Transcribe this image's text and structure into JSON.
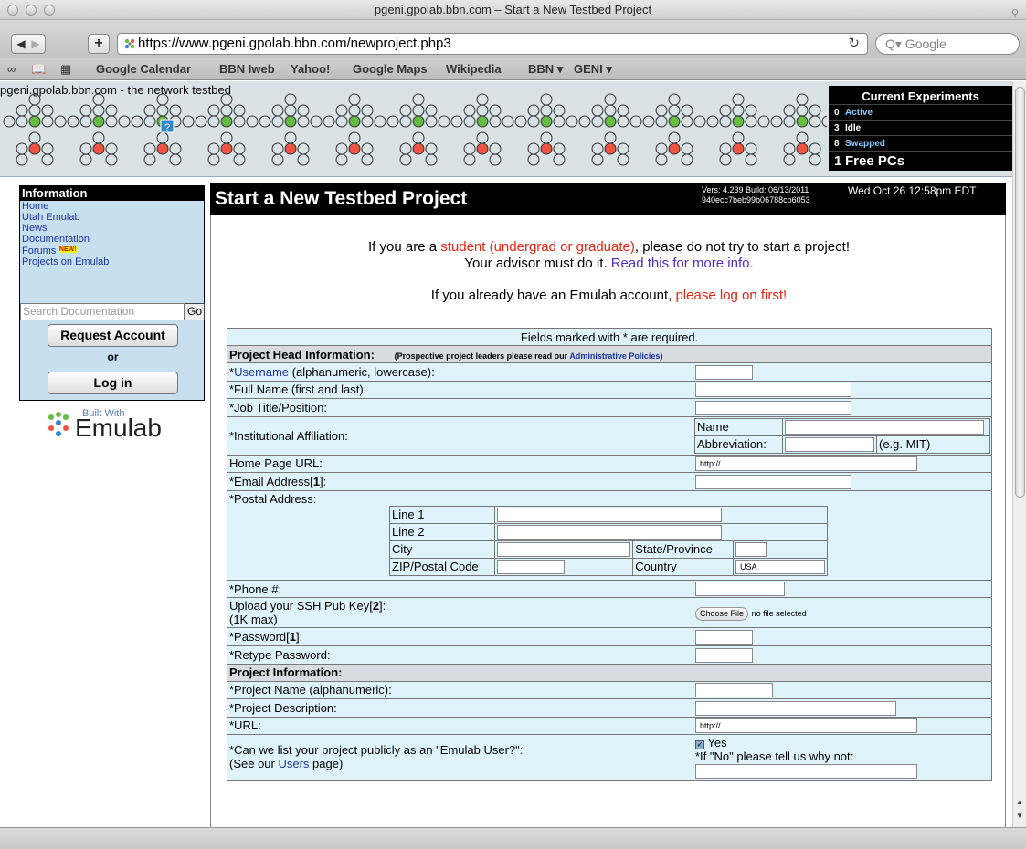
{
  "window": {
    "title": "pgeni.gpolab.bbn.com – Start a New Testbed Project"
  },
  "toolbar": {
    "url": "https://www.pgeni.gpolab.bbn.com/newproject.php3",
    "search_placeholder": "Q▾ Google"
  },
  "bookmarks": [
    "Google Calendar",
    "BBN Iweb",
    "Yahoo!",
    "Google Maps",
    "Wikipedia",
    "BBN ▾",
    "GENI ▾"
  ],
  "banner": {
    "title": "pgeni.gpolab.bbn.com - the network testbed",
    "experiments": {
      "heading": "Current Experiments",
      "active_count": "0",
      "active_label": "Active",
      "idle_count": "3",
      "idle_label": "Idle",
      "swapped_count": "8",
      "swapped_label": "Swapped",
      "free_count": "1",
      "free_label": "Free PCs"
    }
  },
  "sidebar": {
    "heading": "Information",
    "links": [
      "Home",
      "Utah Emulab",
      "News",
      "Documentation",
      "Forums",
      "Projects on Emulab"
    ],
    "new_badge": "NEW!",
    "search_placeholder": "Search Documentation",
    "go_label": "Go",
    "request_account": "Request Account",
    "or": "or",
    "log_in": "Log in",
    "built_with_small": "Built With",
    "built_with_big": "Emulab"
  },
  "header": {
    "title": "Start a New Testbed Project",
    "version_line1": "Vers: 4.239 Build: 06/13/2011",
    "version_line2": "940ecc7beb99b06788cb6053",
    "date": "Wed Oct 26 12:58pm EDT"
  },
  "intro": {
    "line1_pre": "If you are a ",
    "line1_link": "student (undergrad or graduate)",
    "line1_post": ", please do not try to start a project!",
    "line2_pre": "Your advisor must do it. ",
    "line2_link": "Read this for more info.",
    "line3_pre": "If you already have an Emulab account, ",
    "line3_link": "please log on first!"
  },
  "form": {
    "required_note": "Fields marked with * are required.",
    "section1": "Project Head Information:",
    "section1_note_pre": "(Prospective project leaders please read our ",
    "section1_note_link": "Administrative Policies",
    "section1_note_post": ")",
    "username_star": "*",
    "username_link": "Username",
    "username_rest": " (alphanumeric, lowercase):",
    "fullname": "*Full Name (first and last):",
    "jobtitle": "*Job Title/Position:",
    "affiliation": "*Institutional Affiliation:",
    "aff_name": "Name",
    "aff_abbrev": "Abbreviation:",
    "aff_example": "(e.g. MIT)",
    "homepage": "Home Page URL:",
    "homepage_value": "http://",
    "email_pre": "*Email Address[",
    "email_num": "1",
    "email_post": "]:",
    "postal": "*Postal Address:",
    "line1": "Line 1",
    "line2": "Line 2",
    "city": "City",
    "state": "State/Province",
    "zip": "ZIP/Postal Code",
    "country": "Country",
    "country_value": "USA",
    "phone": "*Phone #:",
    "sshkey_pre": "Upload your SSH Pub Key[",
    "sshkey_num": "2",
    "sshkey_post": "]:",
    "sshkey_max": "(1K max)",
    "choose_file": "Choose File",
    "no_file": "no file selected",
    "password_pre": "*Password[",
    "password_num": "1",
    "password_post": "]:",
    "retype": "*Retype Password:",
    "section2": "Project Information:",
    "projname": "*Project Name (alphanumeric):",
    "projdesc": "*Project Description:",
    "projurl": "*URL:",
    "projurl_value": "http://",
    "listq": "*Can we list your project publicly as an \"Emulab User?\":",
    "listq_see_pre": "(See our ",
    "listq_see_link": "Users",
    "listq_see_post": " page)",
    "yes": "Yes",
    "ifno": "*If \"No\" please tell us why not:"
  }
}
